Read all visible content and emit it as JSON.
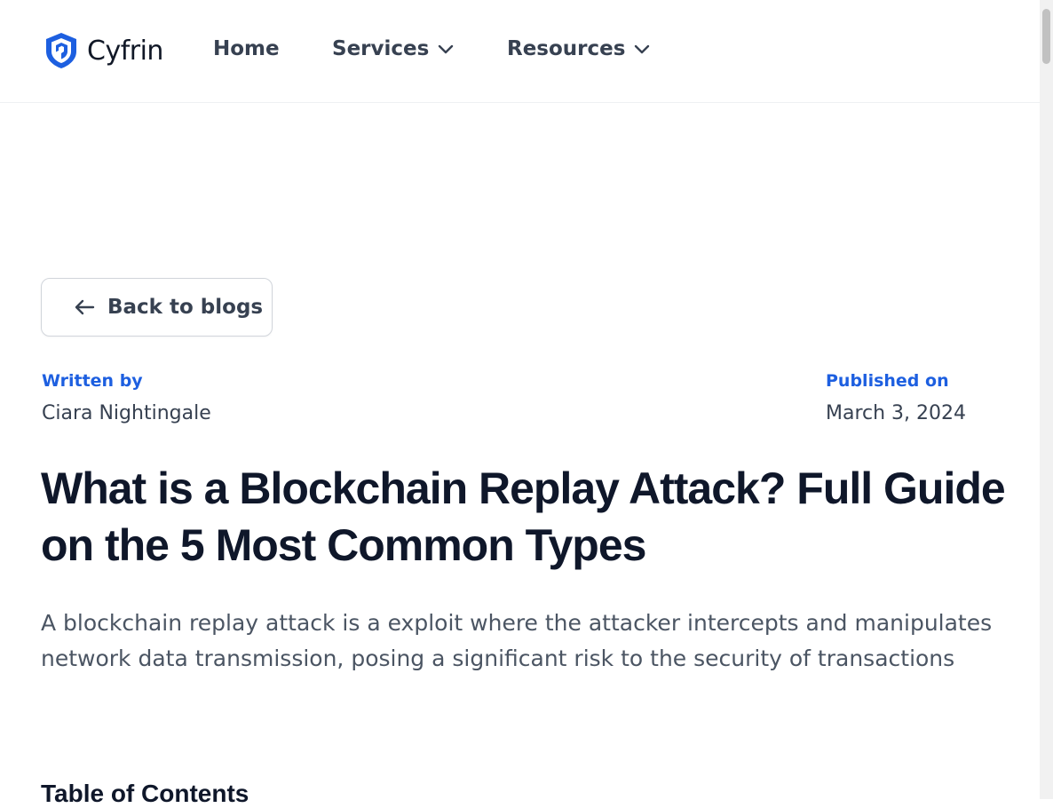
{
  "brand": {
    "name": "Cyfrin",
    "logo_icon": "shield-logo-icon",
    "accent": "#1d5fe0"
  },
  "nav": {
    "home": "Home",
    "services": "Services",
    "resources": "Resources",
    "dropdown_icon": "chevron-down-icon"
  },
  "back_button": {
    "label": "Back to blogs",
    "icon": "arrow-left-icon"
  },
  "meta": {
    "author_label": "Written by",
    "author": "Ciara Nightingale",
    "date_label": "Published on",
    "date": "March 3, 2024"
  },
  "article": {
    "title": "What is a Blockchain Replay Attack? Full Guide on the 5 Most Common Types",
    "intro": "A blockchain replay attack is a exploit where the attacker intercepts and manipulates network data transmission, posing a significant risk to the security of transactions",
    "toc_heading": "Table of Contents"
  }
}
